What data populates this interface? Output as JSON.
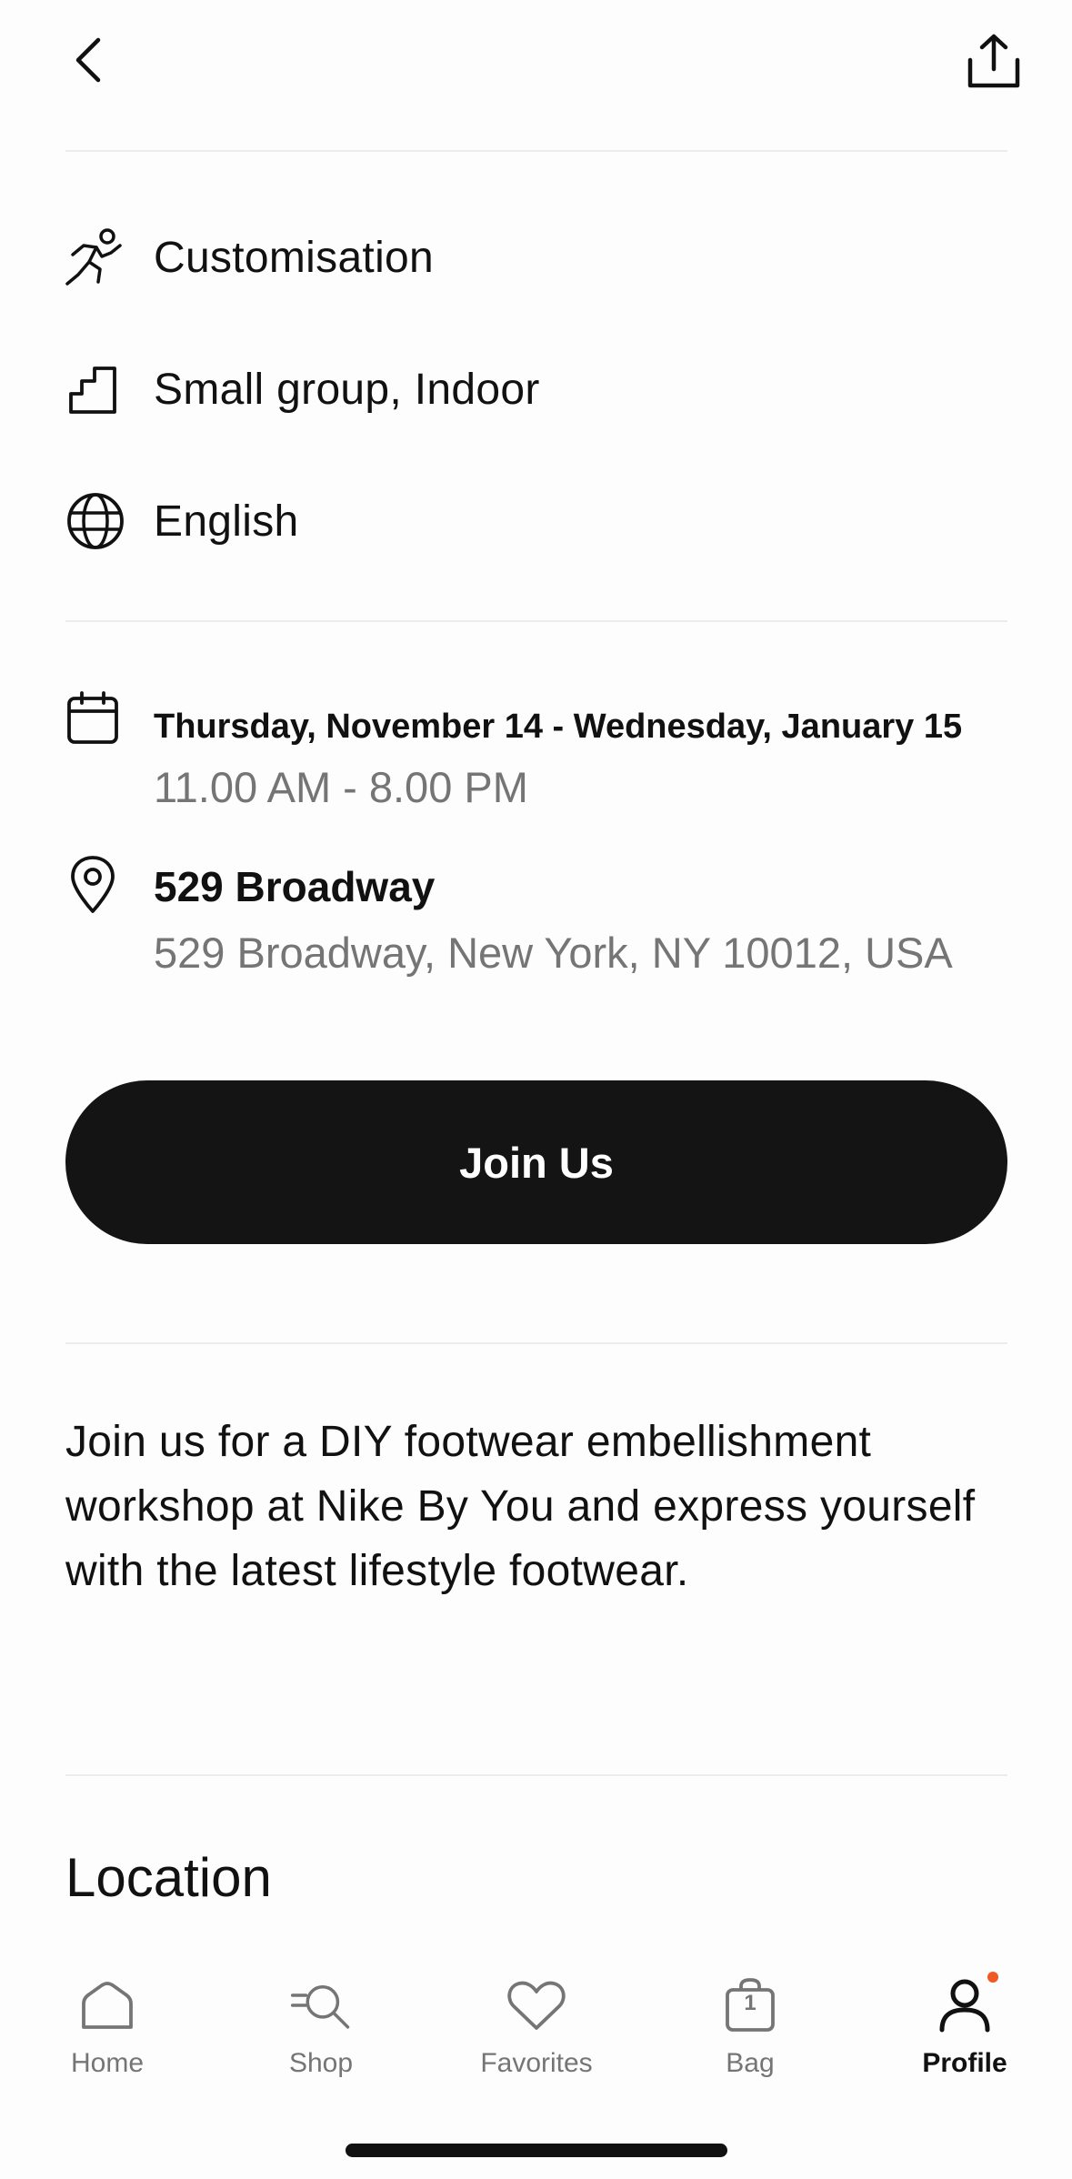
{
  "header": {
    "back_icon": "chevron-left-icon",
    "share_icon": "share-icon"
  },
  "attributes": [
    {
      "icon": "runner-icon",
      "label": "Customisation"
    },
    {
      "icon": "stairs-icon",
      "label": "Small group, Indoor"
    },
    {
      "icon": "globe-icon",
      "label": "English"
    }
  ],
  "schedule": {
    "icon": "calendar-icon",
    "dates": "Thursday, November 14 - Wednesday, January 15",
    "hours": "11.00 AM - 8.00 PM"
  },
  "venue": {
    "icon": "location-pin-icon",
    "name": "529 Broadway",
    "address": "529 Broadway, New York, NY 10012, USA"
  },
  "cta": {
    "label": "Join Us"
  },
  "description": "Join us for a DIY footwear embellishment workshop at Nike By You and express yourself with the latest lifestyle footwear.",
  "location_section": {
    "title": "Location"
  },
  "tabbar": {
    "tabs": [
      {
        "icon": "home-icon",
        "label": "Home"
      },
      {
        "icon": "shop-search-icon",
        "label": "Shop"
      },
      {
        "icon": "heart-icon",
        "label": "Favorites"
      },
      {
        "icon": "bag-icon",
        "label": "Bag",
        "badge": "1"
      },
      {
        "icon": "profile-icon",
        "label": "Profile",
        "active": true
      }
    ],
    "notification_dot_color": "#f05a22"
  },
  "colors": {
    "cta_background": "#141414",
    "cta_text": "#ffffff",
    "secondary_text": "#757575",
    "divider": "#ececec"
  }
}
